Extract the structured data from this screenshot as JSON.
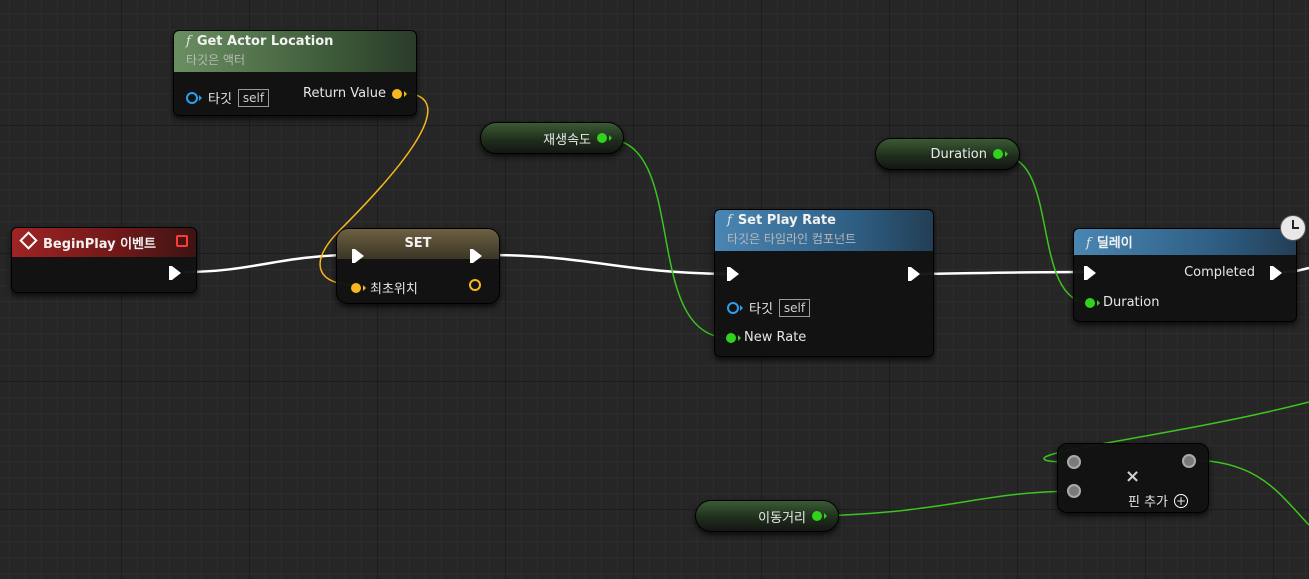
{
  "nodes": {
    "get_actor_location": {
      "title": "Get Actor Location",
      "subtitle": "타깃은 액터",
      "target_label": "타깃",
      "self_label": "self",
      "return_label": "Return Value"
    },
    "begin_play": {
      "title": "BeginPlay 이벤트"
    },
    "set": {
      "title": "SET",
      "var_label": "최초위치"
    },
    "set_play_rate": {
      "title": "Set Play Rate",
      "subtitle": "타깃은 타임라인 컴포넌트",
      "target_label": "타깃",
      "self_label": "self",
      "rate_label": "New Rate"
    },
    "delay": {
      "title": "딜레이",
      "completed_label": "Completed",
      "duration_label": "Duration"
    },
    "multiply": {
      "add_pin_label": "핀 추가"
    }
  },
  "variables": {
    "play_speed": "재생속도",
    "duration": "Duration",
    "move_distance": "이동거리"
  },
  "icons": {
    "function": "f",
    "event": "diamond-icon",
    "clock": "clock-icon",
    "multiply": "×",
    "add": "+"
  },
  "colors": {
    "exec_wire": "#ffffff",
    "float_pin": "#33d11f",
    "vector_pin": "#f6b81c",
    "object_pin": "#2aa0ef"
  }
}
